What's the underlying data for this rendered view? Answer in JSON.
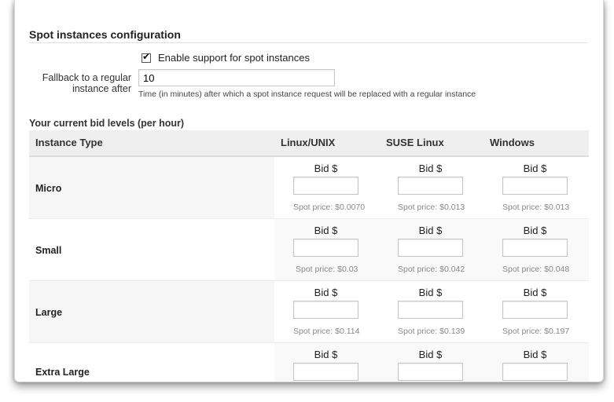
{
  "section": {
    "title": "Spot instances configuration"
  },
  "spot_support": {
    "checked": true,
    "label": "Enable support for spot instances"
  },
  "fallback": {
    "label_line1": "Fallback to a regular",
    "label_line2": "instance after",
    "value": "10",
    "hint": "Time (in minutes) after which a spot instance request will be replaced with a regular instance"
  },
  "bids": {
    "title": "Your current bid levels (per hour)",
    "headers": {
      "instance_type": "Instance Type",
      "linux": "Linux/UNIX",
      "suse": "SUSE Linux",
      "windows": "Windows"
    },
    "rows": [
      {
        "type": "Micro",
        "cols": [
          {
            "bid_label": "Bid $",
            "bid_value": "",
            "spot": "Spot price: $0.0070"
          },
          {
            "bid_label": "Bid $",
            "bid_value": "",
            "spot": "Spot price: $0.013"
          },
          {
            "bid_label": "Bid $",
            "bid_value": "",
            "spot": "Spot price: $0.013"
          }
        ]
      },
      {
        "type": "Small",
        "cols": [
          {
            "bid_label": "Bid $",
            "bid_value": "",
            "spot": "Spot price: $0.03"
          },
          {
            "bid_label": "Bid $",
            "bid_value": "",
            "spot": "Spot price: $0.042"
          },
          {
            "bid_label": "Bid $",
            "bid_value": "",
            "spot": "Spot price: $0.048"
          }
        ]
      },
      {
        "type": "Large",
        "cols": [
          {
            "bid_label": "Bid $",
            "bid_value": "",
            "spot": "Spot price: $0.114"
          },
          {
            "bid_label": "Bid $",
            "bid_value": "",
            "spot": "Spot price: $0.139"
          },
          {
            "bid_label": "Bid $",
            "bid_value": "",
            "spot": "Spot price: $0.197"
          }
        ]
      },
      {
        "type": "Extra Large",
        "cols": [
          {
            "bid_label": "Bid $",
            "bid_value": "",
            "spot": ""
          },
          {
            "bid_label": "Bid $",
            "bid_value": "",
            "spot": ""
          },
          {
            "bid_label": "Bid $",
            "bid_value": "",
            "spot": ""
          }
        ]
      }
    ]
  }
}
